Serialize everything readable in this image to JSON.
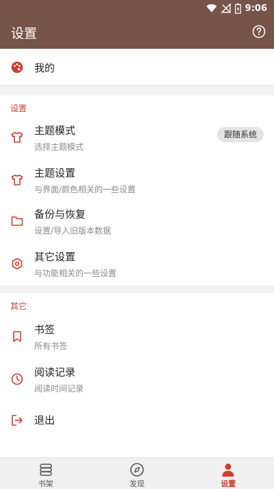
{
  "status_bar": {
    "time": "9:06"
  },
  "app_bar": {
    "title": "设置"
  },
  "me": {
    "label": "我的"
  },
  "settings_section": {
    "header": "设置",
    "items": [
      {
        "title": "主题模式",
        "subtitle": "选择主题模式",
        "value": "跟随系统",
        "icon": "tshirt-icon"
      },
      {
        "title": "主题设置",
        "subtitle": "与界面/颜色相关的一些设置",
        "icon": "tshirt-icon"
      },
      {
        "title": "备份与恢复",
        "subtitle": "设置/导入旧版本数据",
        "icon": "folder-icon"
      },
      {
        "title": "其它设置",
        "subtitle": "与功能相关的一些设置",
        "icon": "hexagon-icon"
      }
    ]
  },
  "others_section": {
    "header": "其它",
    "items": [
      {
        "title": "书签",
        "subtitle": "所有书签",
        "icon": "bookmark-icon"
      },
      {
        "title": "阅读记录",
        "subtitle": "阅读时间记录",
        "icon": "clock-icon"
      },
      {
        "title": "退出",
        "icon": "exit-icon"
      }
    ]
  },
  "bottom_nav": {
    "items": [
      {
        "label": "书架",
        "icon": "bookshelf-icon",
        "active": false
      },
      {
        "label": "发现",
        "icon": "compass-icon",
        "active": false
      },
      {
        "label": "设置",
        "icon": "person-icon",
        "active": true
      }
    ]
  },
  "colors": {
    "app_bar": "#765447",
    "accent": "#d23a2e",
    "background": "#f2f2f2"
  }
}
